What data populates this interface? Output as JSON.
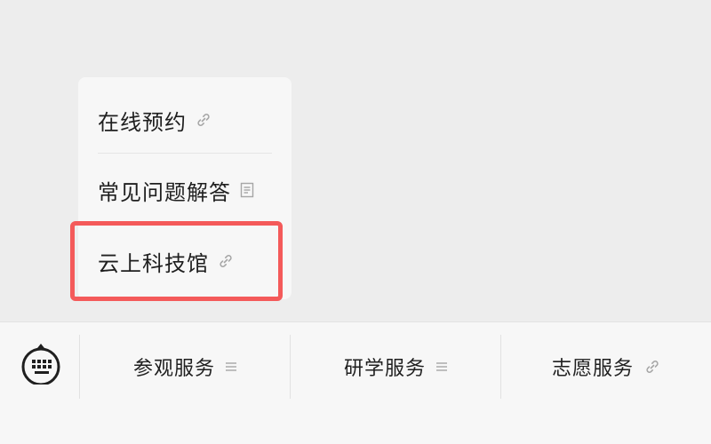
{
  "popup_menu": {
    "items": [
      {
        "label": "在线预约",
        "icon": "link-icon"
      },
      {
        "label": "常见问题解答",
        "icon": "document-icon"
      },
      {
        "label": "云上科技馆",
        "icon": "link-icon",
        "highlighted": true
      }
    ]
  },
  "bottom_bar": {
    "keyboard_icon": "keyboard-icon",
    "tabs": [
      {
        "label": "参观服务",
        "icon": "menu-icon"
      },
      {
        "label": "研学服务",
        "icon": "menu-icon"
      },
      {
        "label": "志愿服务",
        "icon": "link-icon"
      }
    ]
  },
  "colors": {
    "background": "#ededed",
    "panel": "#f7f7f7",
    "highlight": "#f45a5a",
    "icon": "#a6a6a6",
    "text": "#1f1f1f"
  }
}
